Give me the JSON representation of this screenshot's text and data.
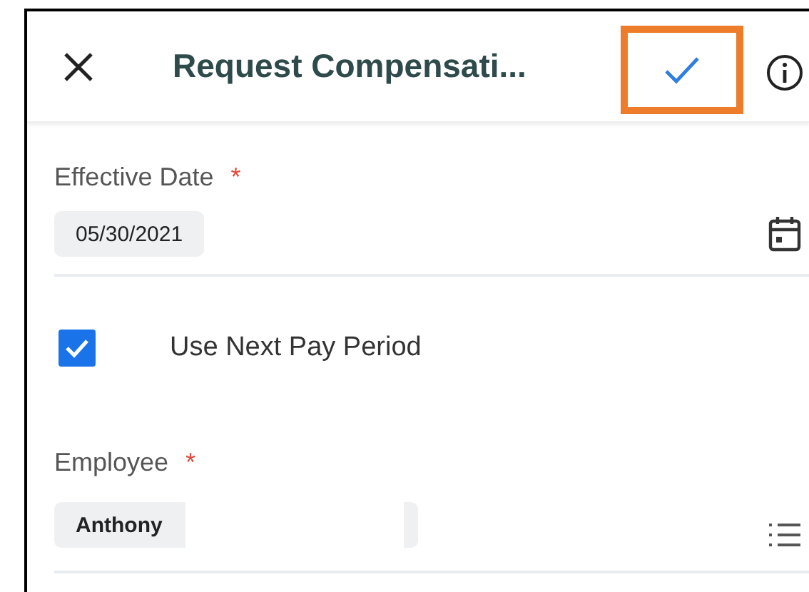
{
  "header": {
    "title": "Request Compensati...",
    "confirm_highlighted": true
  },
  "fields": [
    {
      "kind": "date",
      "label": "Effective Date",
      "required_mark": "*",
      "value": "05/30/2021"
    },
    {
      "kind": "checkbox",
      "label": "Use Next Pay Period",
      "checked": true
    },
    {
      "kind": "prompt",
      "label": "Employee",
      "required_mark": "*",
      "value": "Anthony",
      "redacted": true
    }
  ]
}
